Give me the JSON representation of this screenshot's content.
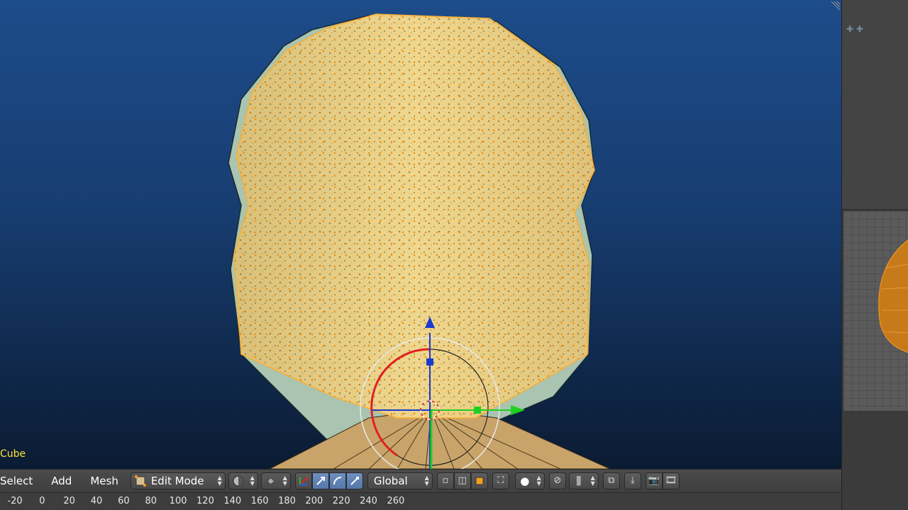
{
  "viewport": {
    "object_name": "Cube"
  },
  "header": {
    "menus": [
      "Select",
      "Add",
      "Mesh"
    ],
    "mode": "Edit Mode",
    "transform_orientation": "Global",
    "icons": {
      "mode": "edit-mode-icon",
      "shading": "viewport-shading-icon",
      "pivot": "pivot-point-icon",
      "manipulator": "manipulator-icon",
      "translate": "translate-icon",
      "rotate": "rotate-icon",
      "scale": "scale-icon",
      "vertex_select": "vertex-select-icon",
      "edge_select": "edge-select-icon",
      "face_select": "face-select-icon",
      "limit_visible": "limit-selection-icon",
      "proportional": "proportional-edit-icon",
      "snap": "snap-icon",
      "snap_target": "snap-element-icon",
      "copy_layer": "copy-icon",
      "paste_layer": "paste-icon",
      "render": "render-icon",
      "render_anim": "render-animation-icon"
    }
  },
  "timeline": {
    "ticks": [
      "-20",
      "0",
      "20",
      "40",
      "60",
      "80",
      "100",
      "120",
      "140",
      "160",
      "180",
      "200",
      "220",
      "240",
      "260"
    ]
  },
  "colors": {
    "viewport_top": "#1d4c8a",
    "viewport_bottom": "#0b1b33",
    "selection": "#ffa500",
    "object_name": "#ffe23a"
  }
}
